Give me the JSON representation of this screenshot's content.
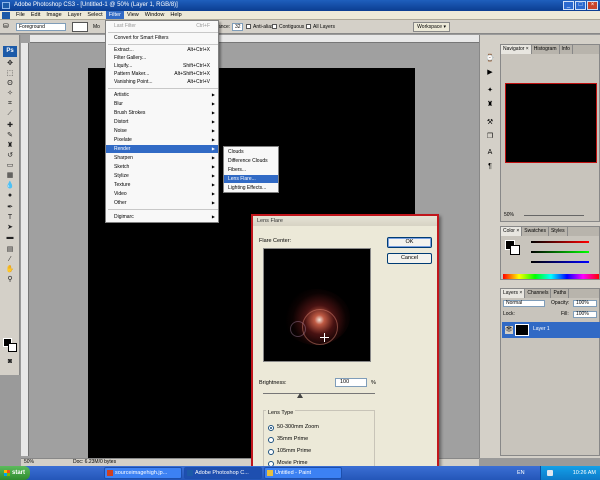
{
  "window": {
    "title": "Adobe Photoshop CS3 - [Untitled-1 @ 50% (Layer 1, RGB/8)]",
    "controls": [
      "_",
      "□",
      "×"
    ]
  },
  "menubar": {
    "items": [
      "File",
      "Edit",
      "Image",
      "Layer",
      "Select",
      "Filter",
      "View",
      "Window",
      "Help"
    ],
    "active_index": 5
  },
  "options_bar": {
    "mode_value": "Foreground",
    "mode_label": "Mo",
    "tolerance_label": "ance:",
    "tolerance_value": "32",
    "anti_alias": "Anti-alias",
    "contiguous": "Contiguous",
    "all_layers": "All Layers",
    "workspace": "Workspace ▾"
  },
  "filter_menu": {
    "last_filter": {
      "label": "Last Filter",
      "shortcut": "Ctrl+F"
    },
    "convert": "Convert for Smart Filters",
    "extract": {
      "label": "Extract...",
      "shortcut": "Alt+Ctrl+X"
    },
    "gallery": "Filter Gallery...",
    "liquify": {
      "label": "Liquify...",
      "shortcut": "Shift+Ctrl+X"
    },
    "pattern": {
      "label": "Pattern Maker...",
      "shortcut": "Alt+Shift+Ctrl+X"
    },
    "vanishing": {
      "label": "Vanishing Point...",
      "shortcut": "Alt+Ctrl+V"
    },
    "groups": [
      "Artistic",
      "Blur",
      "Brush Strokes",
      "Distort",
      "Noise",
      "Pixelate",
      "Render",
      "Sharpen",
      "Sketch",
      "Stylize",
      "Texture",
      "Video",
      "Other"
    ],
    "selected_group": "Render",
    "digimarc": "Digimarc"
  },
  "render_submenu": {
    "items": [
      "Clouds",
      "Difference Clouds",
      "Fibers...",
      "Lens Flare...",
      "Lighting Effects..."
    ],
    "selected": "Lens Flare..."
  },
  "lens_flare": {
    "title": "Lens Flare",
    "flare_center_label": "Flare Center:",
    "ok": "OK",
    "reset": "Cancel",
    "brightness_label": "Brightness:",
    "brightness_value": "100",
    "brightness_unit": "%",
    "brightness_fraction": 0.33,
    "lens_type_label": "Lens Type",
    "lens_types": [
      "50-300mm Zoom",
      "35mm Prime",
      "105mm Prime",
      "Movie Prime"
    ],
    "selected_lens": 0
  },
  "panels": {
    "nav_tabs": [
      "Navigator ×",
      "Histogram",
      "Info"
    ],
    "nav_zoom": "50%",
    "color_tabs": [
      "Color ×",
      "Swatches",
      "Styles"
    ],
    "layer_tabs": [
      "Layers ×",
      "Channels",
      "Paths"
    ],
    "blend_mode": "Normal",
    "opacity_label": "Opacity:",
    "opacity_value": "100%",
    "lock_label": "Lock:",
    "fill_label": "Fill:",
    "fill_value": "100%",
    "layer_name": "Layer 1"
  },
  "statusbar": {
    "zoom": "50%",
    "doc": "Doc: 6.23M/0 bytes"
  },
  "taskbar": {
    "start": "start",
    "tasks": [
      "sourceimagehigh.jp...",
      "Adobe Photoshop C...",
      "Untitled - Paint"
    ],
    "lang": "EN",
    "time": "10:26 AM"
  },
  "colors": {
    "accent": "#316ac5",
    "dialog_border": "#c0161c",
    "titlebar": "#0b3d91"
  }
}
